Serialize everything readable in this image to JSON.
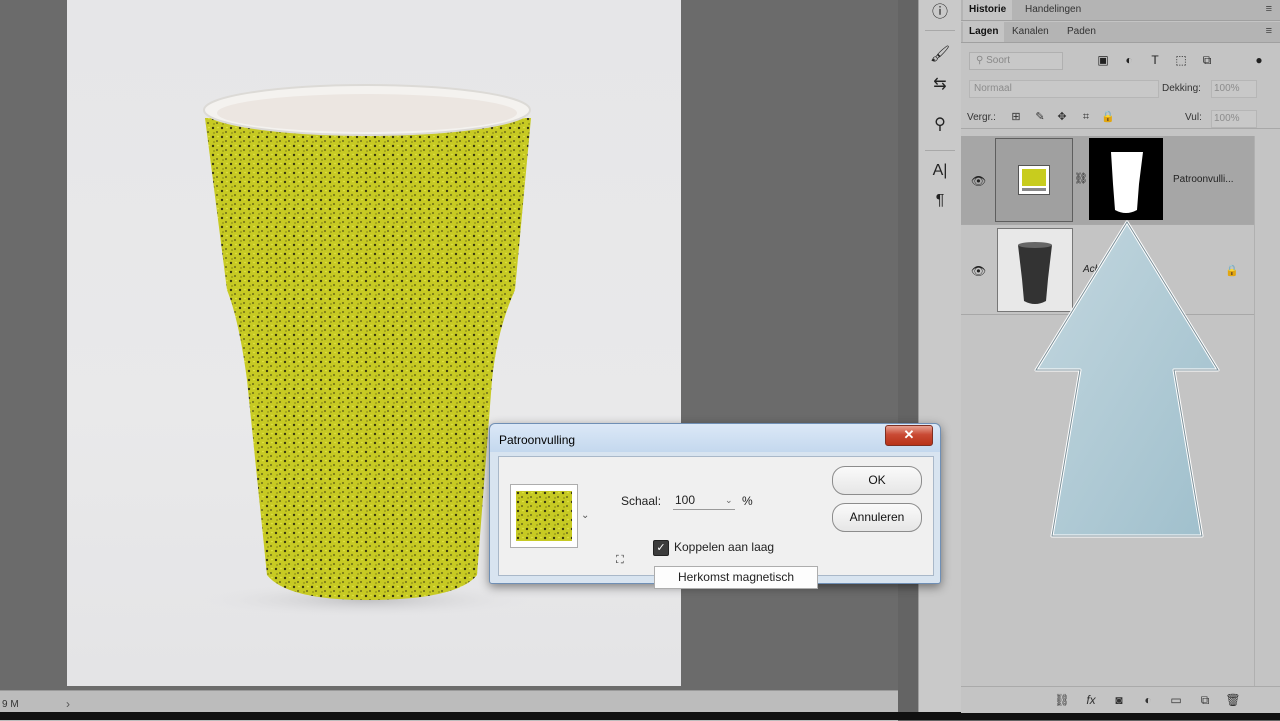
{
  "status": {
    "text": "9 M",
    "arrow": "›"
  },
  "tools": [
    {
      "name": "info-icon",
      "glyph": "ⓘ"
    },
    {
      "name": "brush-icon",
      "glyph": "🖌"
    },
    {
      "name": "adjust-icon",
      "glyph": "⇆"
    },
    {
      "name": "clone-icon",
      "glyph": "⚲"
    },
    {
      "name": "character-icon",
      "glyph": "A|"
    },
    {
      "name": "paragraph-icon",
      "glyph": "¶"
    }
  ],
  "panel_top": {
    "tabs": [
      "Historie",
      "Handelingen"
    ],
    "menu": "≡"
  },
  "panel_layers": {
    "tabs": [
      "Lagen",
      "Kanalen",
      "Paden"
    ],
    "menu": "≡",
    "filter_placeholder": "Soort",
    "blend_mode": "Normaal",
    "opacity_label": "Dekking:",
    "opacity_value": "100%",
    "lock_label": "Vergr.:",
    "fill_label": "Vul:",
    "fill_value": "100%",
    "layers": [
      {
        "name": "Patroonvulli...",
        "visible": true,
        "selected": true
      },
      {
        "name": "Achtergrond",
        "visible": true,
        "locked": true
      }
    ]
  },
  "panel_bottom_icons": [
    "link-icon",
    "fx-icon",
    "mask-icon",
    "adjustment-icon",
    "folder-icon",
    "new-layer-icon",
    "trash-icon"
  ],
  "dialog": {
    "title": "Patroonvulling",
    "close": "✕",
    "scale_label": "Schaal:",
    "scale_value": "100",
    "scale_unit": "%",
    "link_label": "Koppelen aan laag",
    "link_checked": true,
    "origin_button": "Herkomst magnetisch",
    "ok": "OK",
    "cancel": "Annuleren"
  },
  "colors": {
    "pattern": "#c8cc1e",
    "arrow": "#a9c6d2",
    "close": "#c94a34"
  }
}
